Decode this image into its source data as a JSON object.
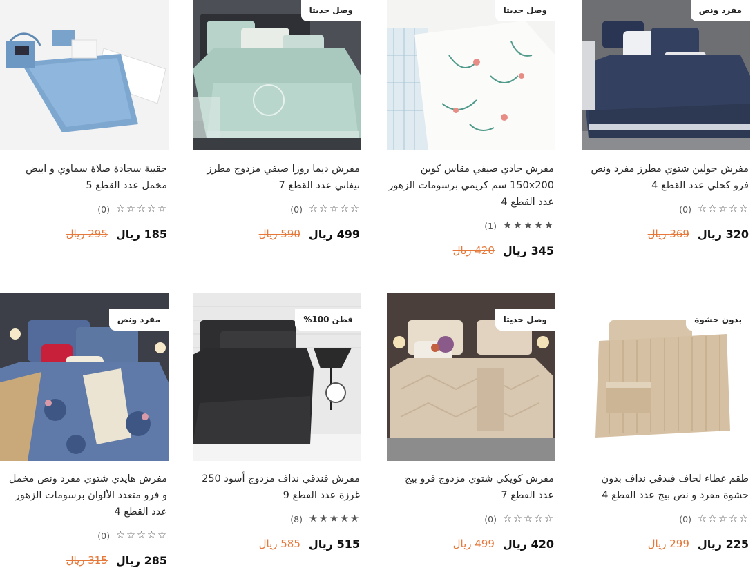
{
  "currency": "ريال",
  "products": [
    {
      "title": "حقيبة سجادة صلاة سماوي و ابيض مخمل عدد القطع 5",
      "badge": "",
      "stars": 0,
      "review_count": "(0)",
      "price": "185",
      "old_price": "295",
      "image": "prayer-rug-bag-image"
    },
    {
      "title": "مفرش ديما روزا صيفي مزدوج مطرز تيفاني عدد القطع 7",
      "badge": "وصل حديثا",
      "stars": 0,
      "review_count": "(0)",
      "price": "499",
      "old_price": "590",
      "image": "tiffany-bedspread-image"
    },
    {
      "title": "مفرش جادي صيفي مقاس كوين 150x200 سم كريمي برسومات الزهور عدد القطع 4",
      "badge": "وصل حديثا",
      "stars": 5,
      "review_count": "(1)",
      "price": "345",
      "old_price": "420",
      "image": "floral-cream-bedspread-image"
    },
    {
      "title": "مفرش جولين شتوي مطرز مفرد ونص فرو كحلي عدد القطع 4",
      "badge": "مفرد ونص",
      "stars": 0,
      "review_count": "(0)",
      "price": "320",
      "old_price": "369",
      "image": "navy-fur-bedspread-image"
    },
    {
      "title": "مفرش هايدي شتوي مفرد ونص مخمل و فرو متعدد الألوان برسومات الزهور عدد القطع 4",
      "badge": "مفرد ونص",
      "stars": 0,
      "review_count": "(0)",
      "price": "285",
      "old_price": "315",
      "image": "multicolor-floral-bedspread-image"
    },
    {
      "title": "مفرش فندقي نداف مزدوج أسود 250 غرزة عدد القطع 9",
      "badge": "قطن 100%",
      "stars": 5,
      "review_count": "(8)",
      "price": "515",
      "old_price": "585",
      "image": "black-hotel-bedspread-image"
    },
    {
      "title": "مفرش كويكي شتوي مزدوج فرو بيج عدد القطع 7",
      "badge": "وصل حديثا",
      "stars": 0,
      "review_count": "(0)",
      "price": "420",
      "old_price": "499",
      "image": "beige-fur-bedspread-image"
    },
    {
      "title": "طقم غطاء لحاف فندقي نداف بدون حشوة مفرد و نص بيج عدد القطع 4",
      "badge": "بدون حشوة",
      "stars": 0,
      "review_count": "(0)",
      "price": "225",
      "old_price": "299",
      "image": "beige-duvet-cover-set-image"
    }
  ],
  "colors": {
    "old_price": "#e6783a",
    "price": "#111111",
    "star": "#555555"
  }
}
